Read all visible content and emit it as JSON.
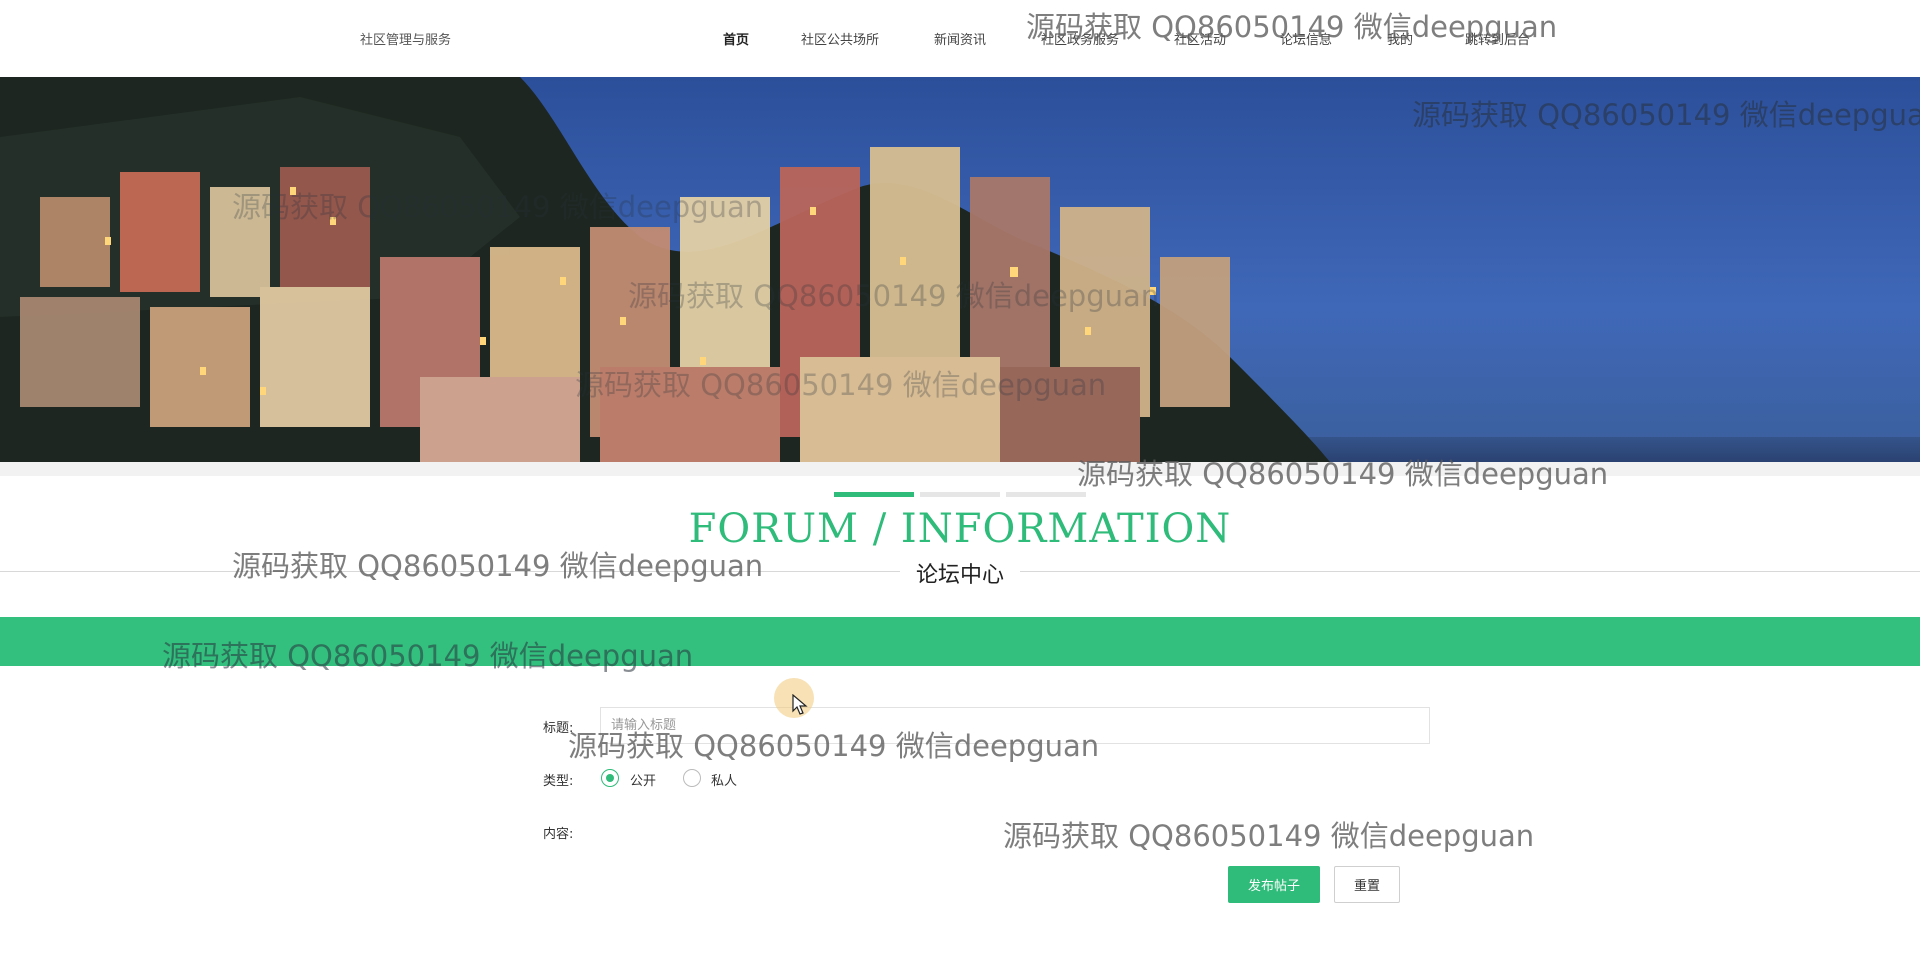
{
  "header": {
    "brand": "社区管理与服务",
    "nav": [
      {
        "label": "首页",
        "active": true
      },
      {
        "label": "社区公共场所"
      },
      {
        "label": "新闻资讯"
      },
      {
        "label": "社区政务服务"
      },
      {
        "label": "社区活动"
      },
      {
        "label": "论坛信息"
      },
      {
        "label": "我的"
      },
      {
        "label": "跳转到后台"
      }
    ]
  },
  "carousel": {
    "slide_count": 3,
    "active_index": 0
  },
  "section": {
    "title_en": "FORUM / INFORMATION",
    "title_cn": "论坛中心"
  },
  "form": {
    "title_label": "标题:",
    "title_placeholder": "请输入标题",
    "title_value": "",
    "type_label": "类型:",
    "type_options": [
      {
        "label": "公开",
        "checked": true
      },
      {
        "label": "私人",
        "checked": false
      }
    ],
    "content_label": "内容:",
    "submit_label": "发布帖子",
    "reset_label": "重置"
  },
  "watermark_text": "源码获取 QQ86050149 微信deepguan",
  "colors": {
    "accent": "#2fbb7a",
    "band": "#33c07e"
  }
}
